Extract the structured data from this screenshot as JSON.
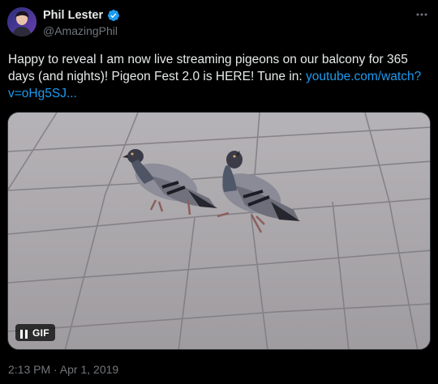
{
  "author": {
    "display_name": "Phil Lester",
    "handle": "@AmazingPhil",
    "verified": true
  },
  "tweet": {
    "text": "Happy to reveal I am now live streaming pigeons on our balcony for 365 days (and nights)! Pigeon Fest 2.0 is HERE! Tune in: ",
    "link_text": "youtube.com/watch?v=oHg5SJ...",
    "timestamp": "2:13 PM · Apr 1, 2019"
  },
  "media": {
    "type": "gif",
    "badge_label": "GIF",
    "alt_subject": "two pigeons on paving stones"
  },
  "icons": {
    "verified": "verified-badge-icon",
    "more": "more-options-icon",
    "pause": "pause-icon"
  },
  "colors": {
    "background": "#000000",
    "text": "#e7e9ea",
    "secondary_text": "#71767b",
    "link": "#1d9bf0",
    "verified": "#1d9bf0"
  }
}
